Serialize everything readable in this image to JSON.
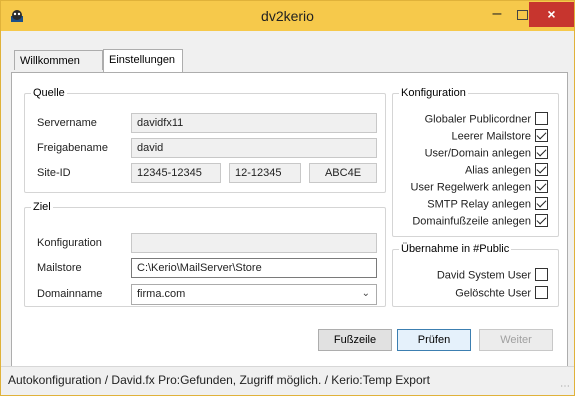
{
  "window": {
    "title": "dv2kerio",
    "close_glyph": "×",
    "minimize_glyph": "–",
    "accent": "#f6c94b",
    "close_color": "#c7352e"
  },
  "tabs": [
    {
      "label": "Willkommen"
    },
    {
      "label": "Einstellungen"
    }
  ],
  "quelle": {
    "legend": "Quelle",
    "servername_label": "Servername",
    "servername_value": "davidfx11",
    "freigabename_label": "Freigabename",
    "freigabename_value": "david",
    "siteid_label": "Site-ID",
    "siteid_part1": "12345-12345",
    "siteid_part2": "12-12345",
    "siteid_part3": "ABC4E"
  },
  "ziel": {
    "legend": "Ziel",
    "konfiguration_label": "Konfiguration",
    "konfiguration_value": "",
    "mailstore_label": "Mailstore",
    "mailstore_value": "C:\\Kerio\\MailServer\\Store",
    "domainname_label": "Domainname",
    "domainname_value": "firma.com"
  },
  "konfiguration": {
    "legend": "Konfiguration",
    "items": [
      {
        "label": "Globaler Publicordner",
        "checked": false
      },
      {
        "label": "Leerer Mailstore",
        "checked": true
      },
      {
        "label": "User/Domain anlegen",
        "checked": true
      },
      {
        "label": "Alias anlegen",
        "checked": true
      },
      {
        "label": "User Regelwerk anlegen",
        "checked": true
      },
      {
        "label": "SMTP Relay anlegen",
        "checked": true
      },
      {
        "label": "Domainfußzeile anlegen",
        "checked": true
      }
    ]
  },
  "uebernahme": {
    "legend": "Übernahme in #Public",
    "items": [
      {
        "label": "David System User",
        "checked": false
      },
      {
        "label": "Gelöschte User",
        "checked": false
      }
    ]
  },
  "buttons": {
    "fusszeile": "Fußzeile",
    "pruefen": "Prüfen",
    "weiter": "Weiter"
  },
  "status": {
    "text": "Autokonfiguration / David.fx Pro:Gefunden, Zugriff möglich. / Kerio:Temp Export"
  }
}
